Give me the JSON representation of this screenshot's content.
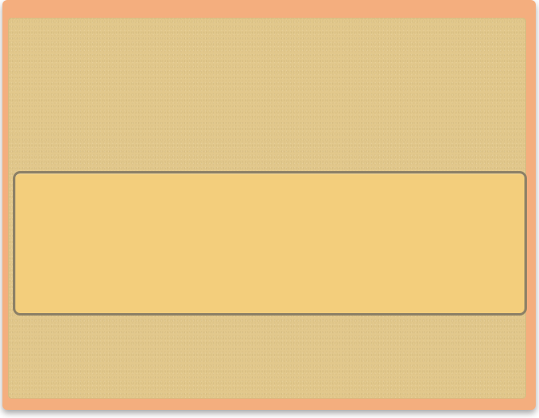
{
  "window": {
    "frame_color": "#f4ae7e",
    "panel_color": "#e2c88c"
  },
  "dialog": {
    "text": "",
    "fill_color": "#f3ce7c",
    "border_color": "#8c8066"
  }
}
